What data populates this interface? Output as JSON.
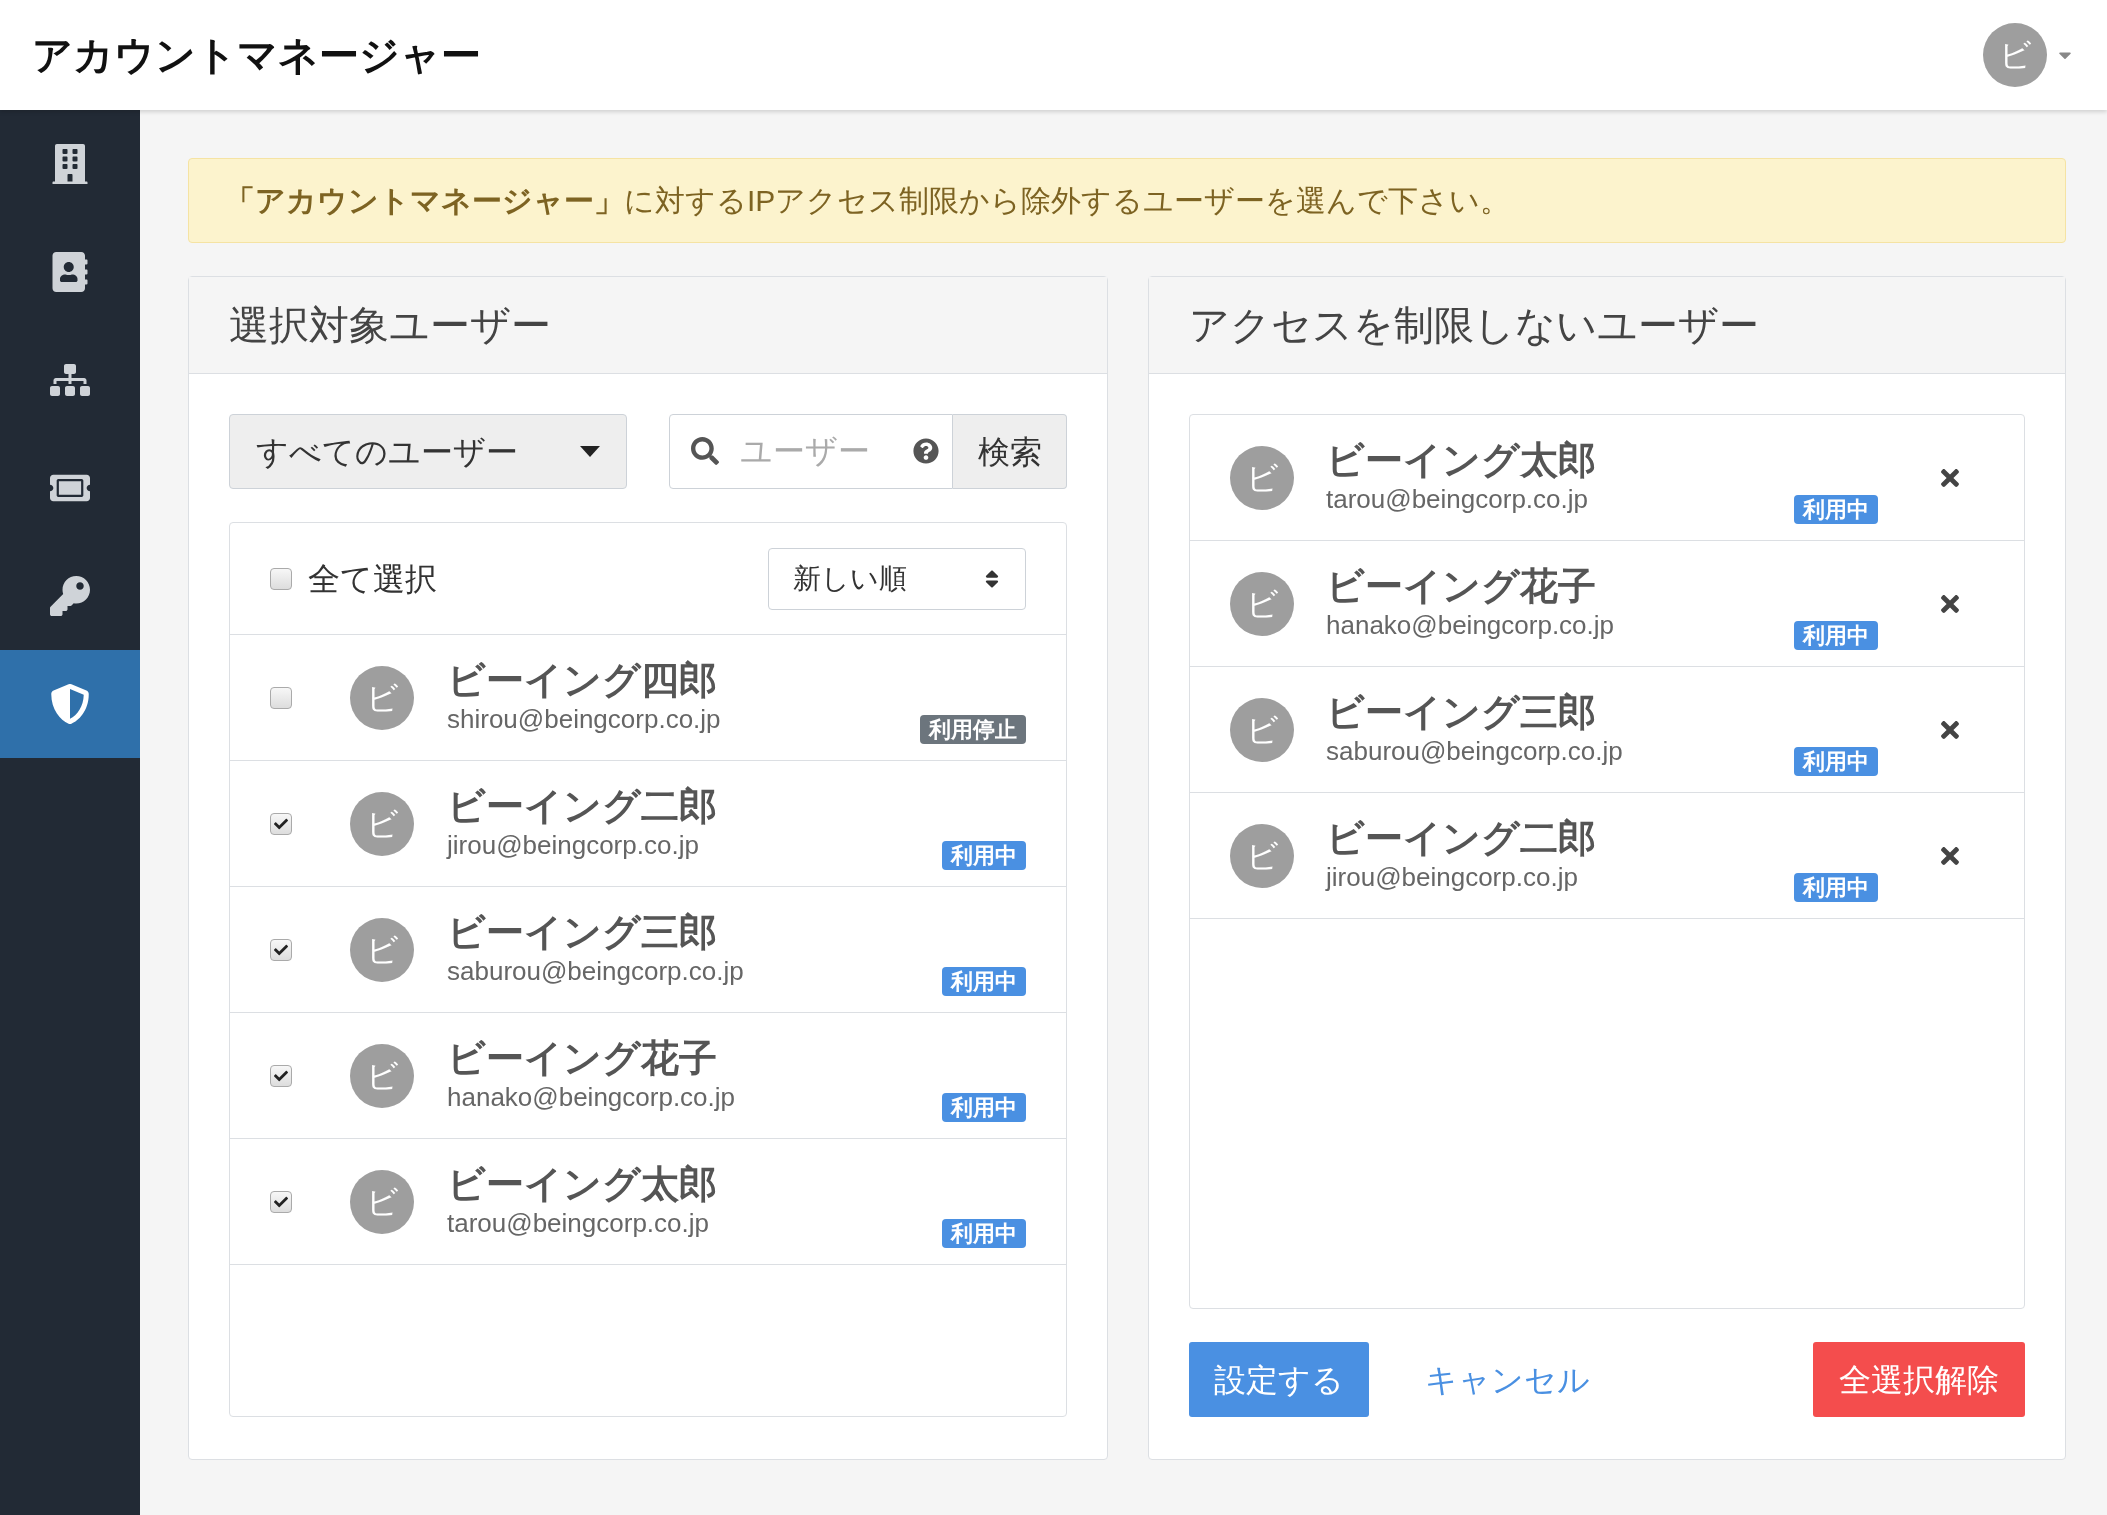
{
  "app_title": "アカウントマネージャー",
  "account": {
    "initial": "ビ"
  },
  "sidebar": {
    "items": [
      {
        "selected": false
      },
      {
        "selected": false
      },
      {
        "selected": false
      },
      {
        "selected": false
      },
      {
        "selected": false
      },
      {
        "selected": true
      }
    ]
  },
  "notice": "**「アカウントマネージャー」**に対するIPアクセス制限から除外するユーザーを選んで下さい。",
  "candidates": {
    "title": "選択対象ユーザー",
    "filter": {
      "value": "すべてのユーザー"
    },
    "search": {
      "placeholder": "ユーザー",
      "button": "検索"
    },
    "select_all": {
      "label": "全て選択",
      "checked": false
    },
    "sort": {
      "value": "新しい順"
    },
    "users": [
      {
        "avatar": "ビ",
        "name": "ビーイング四郎",
        "email": "shirou@beingcorp.co.jp",
        "status": {
          "label": "利用停止",
          "kind": "suspended"
        },
        "checked": false
      },
      {
        "avatar": "ビ",
        "name": "ビーイング二郎",
        "email": "jirou@beingcorp.co.jp",
        "status": {
          "label": "利用中",
          "kind": "active"
        },
        "checked": true
      },
      {
        "avatar": "ビ",
        "name": "ビーイング三郎",
        "email": "saburou@beingcorp.co.jp",
        "status": {
          "label": "利用中",
          "kind": "active"
        },
        "checked": true
      },
      {
        "avatar": "ビ",
        "name": "ビーイング花子",
        "email": "hanako@beingcorp.co.jp",
        "status": {
          "label": "利用中",
          "kind": "active"
        },
        "checked": true
      },
      {
        "avatar": "ビ",
        "name": "ビーイング太郎",
        "email": "tarou@beingcorp.co.jp",
        "status": {
          "label": "利用中",
          "kind": "active"
        },
        "checked": true
      }
    ]
  },
  "excluded": {
    "title": "アクセスを制限しないユーザー",
    "users": [
      {
        "avatar": "ビ",
        "name": "ビーイング太郎",
        "email": "tarou@beingcorp.co.jp",
        "status": {
          "label": "利用中",
          "kind": "active"
        }
      },
      {
        "avatar": "ビ",
        "name": "ビーイング花子",
        "email": "hanako@beingcorp.co.jp",
        "status": {
          "label": "利用中",
          "kind": "active"
        }
      },
      {
        "avatar": "ビ",
        "name": "ビーイング三郎",
        "email": "saburou@beingcorp.co.jp",
        "status": {
          "label": "利用中",
          "kind": "active"
        }
      },
      {
        "avatar": "ビ",
        "name": "ビーイング二郎",
        "email": "jirou@beingcorp.co.jp",
        "status": {
          "label": "利用中",
          "kind": "active"
        }
      }
    ],
    "save_button": "設定する",
    "cancel_link": "キャンセル",
    "clear_button": "全選択解除"
  }
}
